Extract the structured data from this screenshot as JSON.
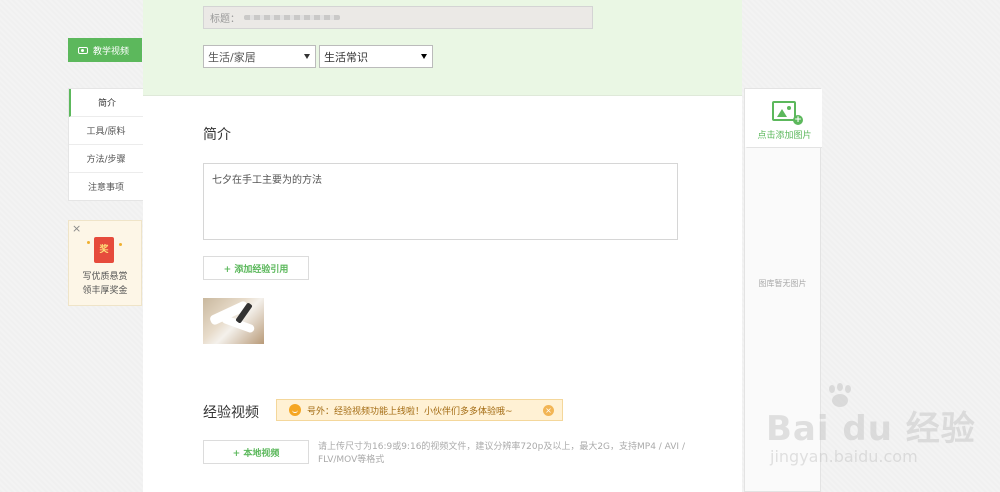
{
  "left_nav": {
    "video_tag": "教学视频",
    "items": [
      {
        "label": "简介",
        "active": true
      },
      {
        "label": "工具/原料",
        "active": false
      },
      {
        "label": "方法/步骤",
        "active": false
      },
      {
        "label": "注意事项",
        "active": false
      }
    ],
    "reward": {
      "close": "×",
      "envelope_char": "奖",
      "line1": "写优质悬赏",
      "line2": "领丰厚奖金"
    }
  },
  "main": {
    "title_field": {
      "label": "标题："
    },
    "category1": "生活/家居",
    "category2": "生活常识",
    "intro": {
      "heading": "简介",
      "text_visible": "七夕在手工主要为的方法"
    },
    "add_reference": "+ 添加经验引用",
    "video": {
      "heading": "经验视频",
      "notice": "号外：经验视频功能上线啦！小伙伴们多多体验哦~",
      "notice_close": "×",
      "local_button": "+ 本地视频",
      "hint": "请上传尺寸为16:9或9:16的视频文件，建议分辨率720p及以上，最大2G，支持MP4 / AVI / FLV/MOV等格式"
    }
  },
  "right_panel": {
    "add_pic": "点击添加图片",
    "empty": "图库暂无图片"
  },
  "watermark": {
    "brand": "Bai du 经验",
    "url": "jingyan.baidu.com"
  },
  "colors": {
    "accent": "#5cb85c",
    "top_band": "#eaf7e4",
    "notice_bg": "#fff1d4"
  }
}
